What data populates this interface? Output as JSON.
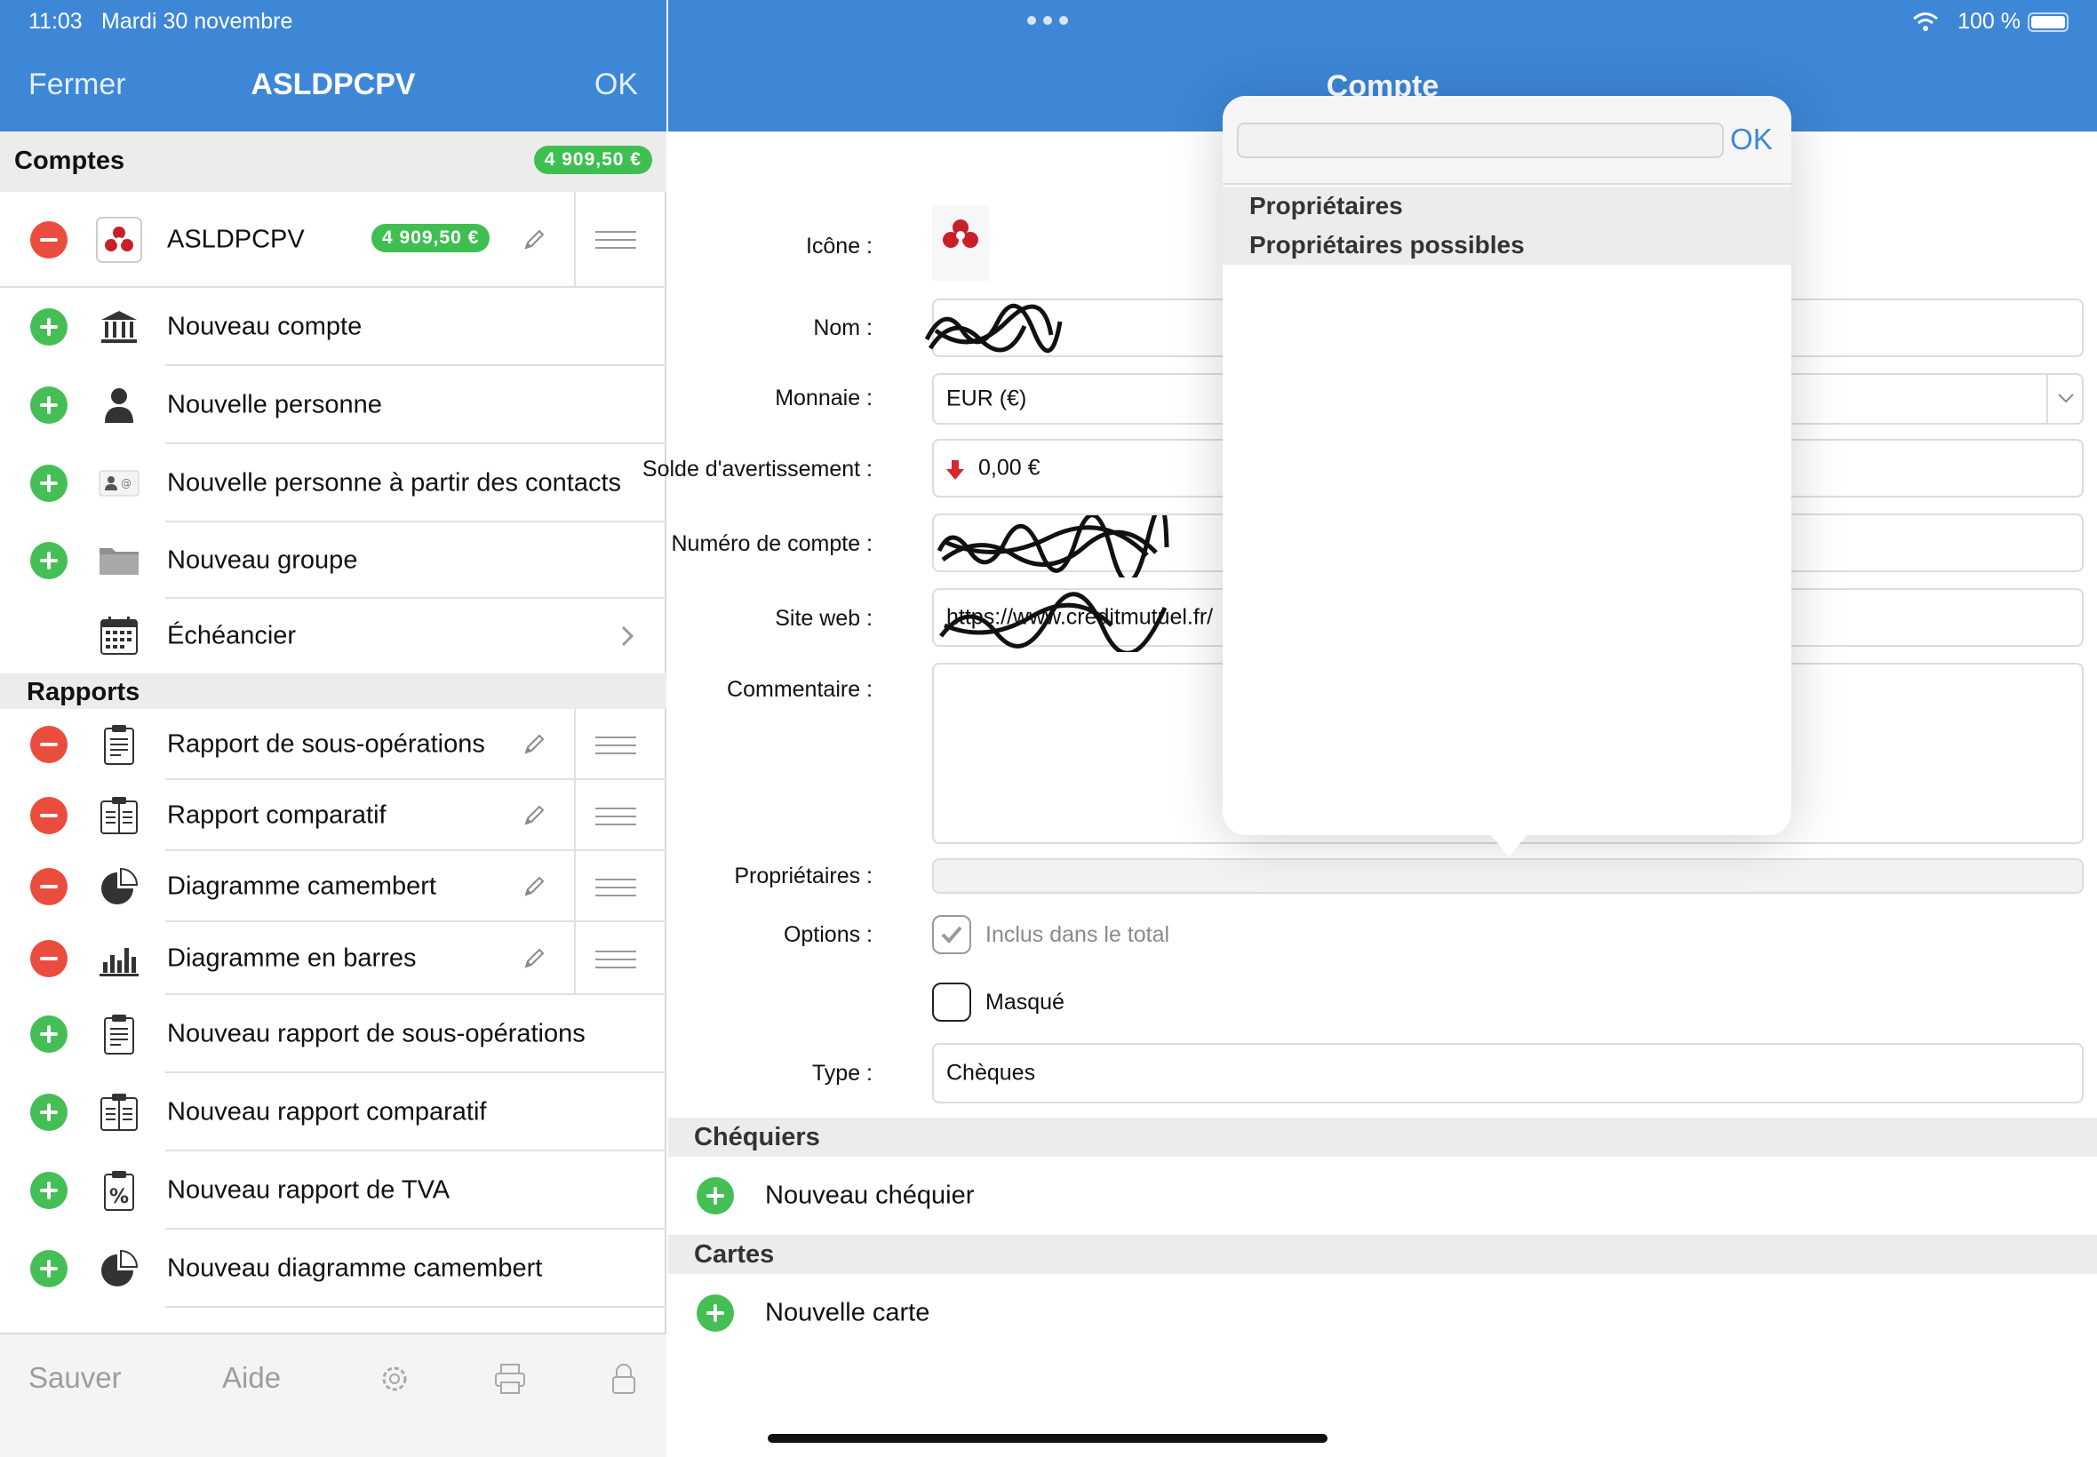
{
  "status": {
    "time": "11:03",
    "date": "Mardi 30 novembre",
    "battery": "100 %"
  },
  "left": {
    "nav": {
      "close": "Fermer",
      "title": "ASLDPCPV",
      "ok": "OK"
    },
    "comptes": {
      "header": "Comptes",
      "total": "4 909,50 €",
      "account": {
        "name": "ASLDPCPV",
        "balance": "4 909,50 €"
      },
      "new_account": "Nouveau compte",
      "new_person": "Nouvelle personne",
      "new_person_contacts": "Nouvelle personne à partir des contacts",
      "new_group": "Nouveau groupe",
      "schedule": "Échéancier"
    },
    "rapports": {
      "header": "Rapports",
      "items": [
        "Rapport de sous-opérations",
        "Rapport comparatif",
        "Diagramme camembert",
        "Diagramme en barres"
      ],
      "new_items": [
        "Nouveau rapport de sous-opérations",
        "Nouveau rapport comparatif",
        "Nouveau rapport de TVA",
        "Nouveau diagramme camembert"
      ]
    },
    "bottom": {
      "save": "Sauver",
      "help": "Aide"
    }
  },
  "right": {
    "nav": {
      "title": "Compte"
    },
    "form": {
      "icon_label": "Icône :",
      "name_label": "Nom :",
      "currency_label": "Monnaie :",
      "currency_value": "EUR (€)",
      "warning_label": "Solde d'avertissement :",
      "warning_value": "0,00 €",
      "number_label": "Numéro de compte :",
      "website_label": "Site web :",
      "website_value": "https://www.creditmutuel.fr/",
      "comment_label": "Commentaire :",
      "owners_label": "Propriétaires :",
      "options_label": "Options :",
      "option_total": "Inclus dans le total",
      "option_hidden": "Masqué",
      "type_label": "Type :",
      "type_value": "Chèques"
    },
    "chequiers": {
      "header": "Chéquiers",
      "new": "Nouveau chéquier"
    },
    "cartes": {
      "header": "Cartes",
      "new": "Nouvelle carte"
    }
  },
  "popover": {
    "ok": "OK",
    "owners": "Propriétaires",
    "possible_owners": "Propriétaires possibles"
  },
  "colors": {
    "accent": "#3d87d6",
    "add": "#45bf55",
    "delete": "#ea4d3d",
    "badge": "#3fbf52"
  }
}
